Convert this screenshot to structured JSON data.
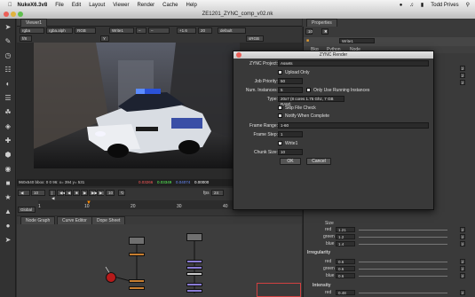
{
  "menubar": {
    "app": "NukeX6.3v8",
    "items": [
      "File",
      "Edit",
      "Layout",
      "Viewer",
      "Render",
      "Cache",
      "Help"
    ],
    "user": "Todd Prives"
  },
  "window": {
    "title": "ZE1201_ZYNC_comp_v02.nk"
  },
  "viewer": {
    "tab": "Viewer1",
    "channels": "rgba",
    "alpha": "rgba.alph",
    "colorspace": "RGB",
    "input": "Write1",
    "zoom": "+1.6",
    "frame_step": "20",
    "lut": "default",
    "display": "sRGB",
    "info_bbox": "960x540 bbox: 0 0 96: x= 394 y= 531",
    "info_r": "0.03266",
    "info_g": "0.03349",
    "info_b": "0.04074",
    "info_a": "0.00000",
    "info_h": "H:2"
  },
  "timeline": {
    "frame": "10",
    "fps_label": "fps",
    "fps": "24",
    "ticks": [
      "1",
      "10",
      "20",
      "30",
      "40"
    ],
    "global": "Global"
  },
  "nodegraph": {
    "tabs": [
      "Node Graph",
      "Curve Editor",
      "Dope Sheet"
    ]
  },
  "properties": {
    "tab": "Properties",
    "node_name": "Write1",
    "node_tab_labels": [
      "Bkg",
      "Python",
      "Node"
    ],
    "size_label": "Size",
    "size_rows": [
      {
        "label": "red",
        "value": "1.21"
      },
      {
        "label": "green",
        "value": "1.2"
      },
      {
        "label": "blue",
        "value": "1.4"
      }
    ],
    "irregularity_label": "Irregularity",
    "irregularity_rows": [
      {
        "label": "red",
        "value": "0.6"
      },
      {
        "label": "green",
        "value": "0.6"
      },
      {
        "label": "blue",
        "value": "0.6"
      }
    ],
    "intensity_label": "Intensity",
    "intensity_rows": [
      {
        "label": "red",
        "value": "0.48"
      }
    ]
  },
  "dialog": {
    "title": "ZYNC Render",
    "project_label": "ZYNC Project:",
    "project_value": "Assets",
    "upload_only": "Upload Only",
    "priority_label": "Job Priority:",
    "priority_value": "50",
    "instances_label": "Num. Instances:",
    "instances_value": "5",
    "running_only": "Only Use Running Instances",
    "type_label": "Type:",
    "type_value": "20x7 (8 cores 1.75 Ghz, 7 GB RAM)",
    "skip_check": "Skip File Check",
    "notify": "Notify When Complete",
    "frame_range_label": "Frame Range:",
    "frame_range_value": "1-60",
    "frame_step_label": "Frame Step:",
    "frame_step_value": "1",
    "write_node": "Write1",
    "chunk_label": "Chunk Size:",
    "chunk_value": "10",
    "ok": "OK",
    "cancel": "Cancel"
  }
}
